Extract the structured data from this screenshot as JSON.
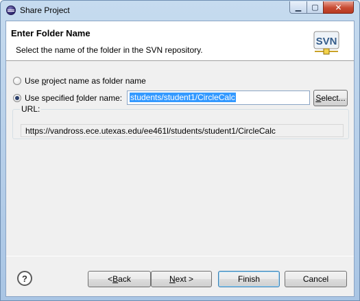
{
  "window": {
    "title": "Share Project",
    "minimize_glyph": "▁",
    "maximize_glyph": "▢",
    "close_glyph": "✕"
  },
  "header": {
    "title": "Enter Folder Name",
    "description": "Select the name of the folder in the SVN repository.",
    "logo_text": "SVN"
  },
  "options": {
    "use_project_name": {
      "prefix": "Use ",
      "accel": "p",
      "suffix": "roject name as folder name",
      "checked": false
    },
    "use_specified_name": {
      "prefix": "Use specified ",
      "accel": "f",
      "suffix": "older name:",
      "checked": true
    }
  },
  "folder_input": {
    "value": "students/student1/CircleCalc"
  },
  "select_button": {
    "accel": "S",
    "suffix": "elect..."
  },
  "url_group": {
    "label": "URL:",
    "value": "https://vandross.ece.utexas.edu/ee461l/students/student1/CircleCalc"
  },
  "footer": {
    "help_glyph": "?",
    "back": {
      "prefix": "< ",
      "accel": "B",
      "suffix": "ack"
    },
    "next": {
      "accel": "N",
      "suffix": "ext >"
    },
    "finish": {
      "label": "Finish"
    },
    "cancel": {
      "label": "Cancel"
    }
  },
  "colors": {
    "selection": "#3399ff",
    "title_gradient_top": "#c6dbef",
    "close_button": "#c84b32",
    "dialog_bg": "#f0f0f0"
  }
}
